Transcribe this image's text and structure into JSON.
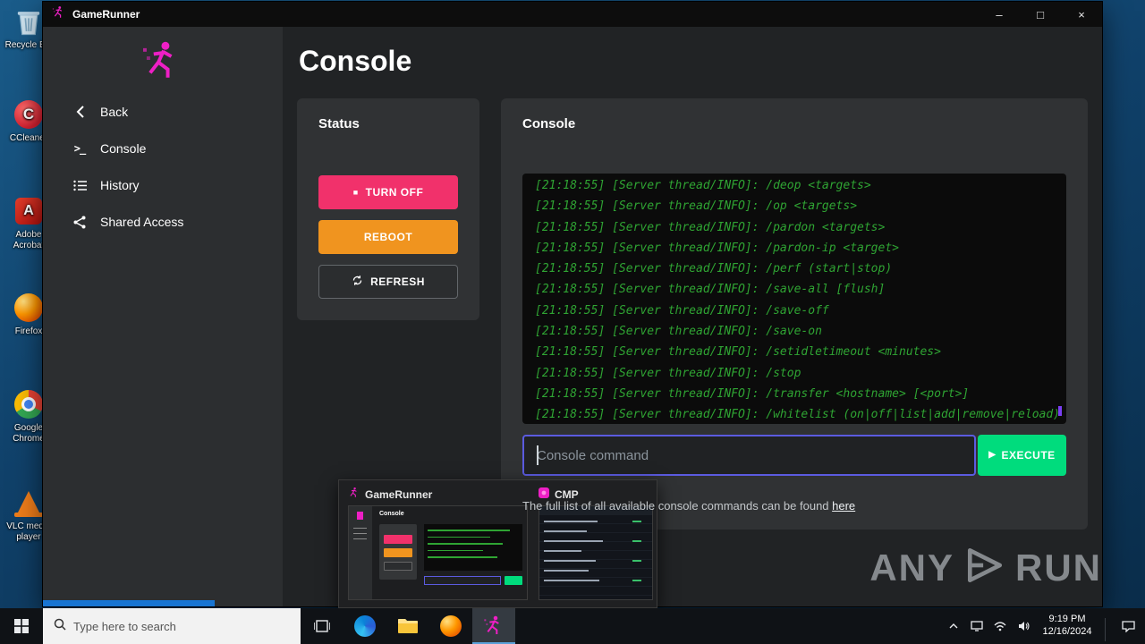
{
  "window": {
    "title": "GameRunner",
    "controls": {
      "minimize": "–",
      "maximize": "□",
      "close": "×"
    }
  },
  "icons": {
    "stop": "■",
    "play": "▶",
    "prompt": ">_"
  },
  "desktop": {
    "icons": [
      {
        "label": "Recycle Bin"
      },
      {
        "label": "CCleaner"
      },
      {
        "label": "Adobe Acrobat"
      },
      {
        "label": "Firefox"
      },
      {
        "label": "Google Chrome"
      },
      {
        "label": "VLC media player"
      }
    ]
  },
  "sidebar": {
    "items": [
      {
        "label": "Back"
      },
      {
        "label": "Console"
      },
      {
        "label": "History"
      },
      {
        "label": "Shared Access"
      }
    ]
  },
  "main": {
    "title": "Console",
    "status": {
      "title": "Status",
      "turn_off": "TURN OFF",
      "reboot": "REBOOT",
      "refresh": "REFRESH"
    },
    "console": {
      "title": "Console",
      "lines": [
        "[21:18:55] [Server thread/INFO]: /deop <targets>",
        "[21:18:55] [Server thread/INFO]: /op <targets>",
        "[21:18:55] [Server thread/INFO]: /pardon <targets>",
        "[21:18:55] [Server thread/INFO]: /pardon-ip <target>",
        "[21:18:55] [Server thread/INFO]: /perf (start|stop)",
        "[21:18:55] [Server thread/INFO]: /save-all [flush]",
        "[21:18:55] [Server thread/INFO]: /save-off",
        "[21:18:55] [Server thread/INFO]: /save-on",
        "[21:18:55] [Server thread/INFO]: /setidletimeout <minutes>",
        "[21:18:55] [Server thread/INFO]: /stop",
        "[21:18:55] [Server thread/INFO]: /transfer <hostname> [<port>]",
        "[21:18:55] [Server thread/INFO]: /whitelist (on|off|list|add|remove|reload)"
      ],
      "input_placeholder": "Console command",
      "execute": "EXECUTE",
      "help_prefix": "The full list of all available console commands can be found ",
      "help_link": "here"
    }
  },
  "thumbnails": {
    "items": [
      {
        "title": "GameRunner"
      },
      {
        "title": "CMP"
      }
    ]
  },
  "watermark": {
    "left": "ANY",
    "right": "RUN"
  },
  "taskbar": {
    "search_placeholder": "Type here to search",
    "time": "9:19 PM",
    "date": "12/16/2024"
  }
}
